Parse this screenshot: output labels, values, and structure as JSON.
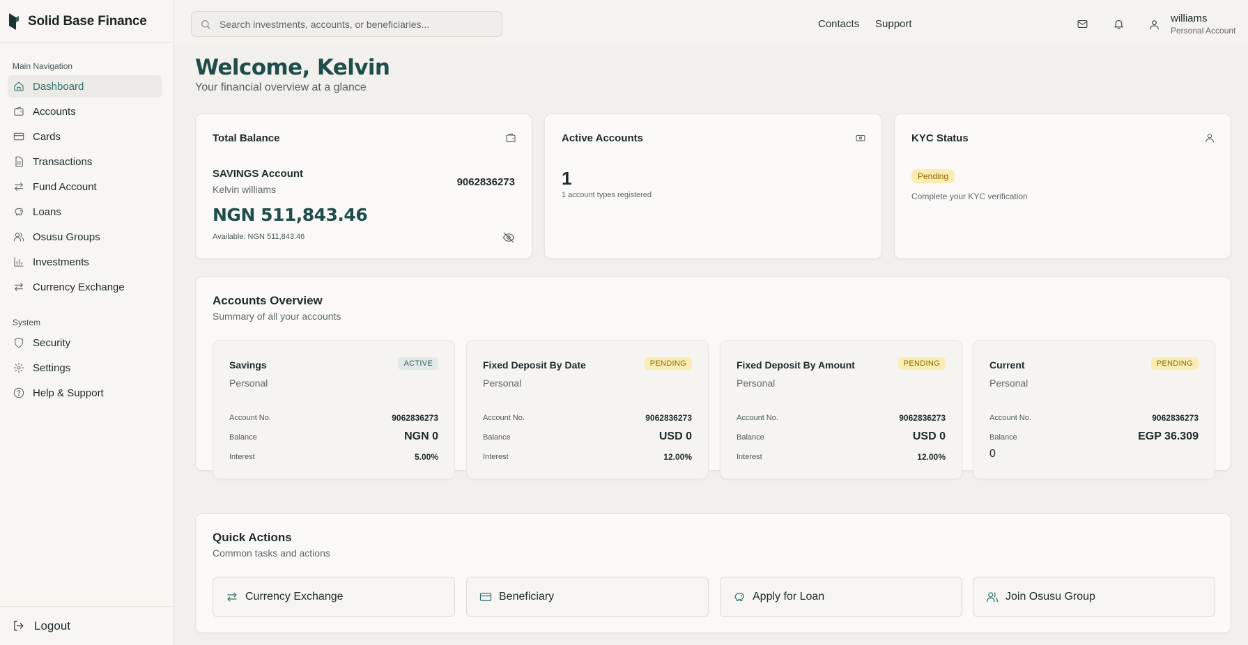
{
  "brand": {
    "name": "Solid Base Finance"
  },
  "sidebar": {
    "main_section": "Main Navigation",
    "items": [
      {
        "label": "Dashboard"
      },
      {
        "label": "Accounts"
      },
      {
        "label": "Cards"
      },
      {
        "label": "Transactions"
      },
      {
        "label": "Fund Account"
      },
      {
        "label": "Loans"
      },
      {
        "label": "Osusu Groups"
      },
      {
        "label": "Investments"
      },
      {
        "label": "Currency Exchange"
      }
    ],
    "system_section": "System",
    "system_items": [
      {
        "label": "Security"
      },
      {
        "label": "Settings"
      },
      {
        "label": "Help & Support"
      }
    ],
    "logout": "Logout"
  },
  "topbar": {
    "search_placeholder": "Search investments, accounts, or beneficiaries...",
    "links": [
      "Contacts",
      "Support"
    ],
    "user_name": "williams",
    "user_type": "Personal Account"
  },
  "welcome": {
    "title": "Welcome, Kelvin",
    "subtitle": "Your financial overview at a glance"
  },
  "total_balance": {
    "title": "Total Balance",
    "account_title": "SAVINGS Account",
    "owner": "Kelvin williams",
    "account_number": "9062836273",
    "balance": "NGN 511,843.46",
    "available": "Available: NGN 511,843.46"
  },
  "active_accounts": {
    "title": "Active Accounts",
    "count": "1",
    "note": "1 account types registered"
  },
  "kyc": {
    "title": "KYC Status",
    "badge": "Pending",
    "note": "Complete your KYC verification"
  },
  "overview": {
    "title": "Accounts Overview",
    "subtitle": "Summary of all your accounts",
    "labels": {
      "account_no": "Account No.",
      "balance": "Balance",
      "interest": "Interest"
    },
    "accounts": [
      {
        "name": "Savings",
        "type": "Personal",
        "status": "ACTIVE",
        "number": "9062836273",
        "balance": "NGN 0",
        "interest": "5.00%"
      },
      {
        "name": "Fixed Deposit By Date",
        "type": "Personal",
        "status": "PENDING",
        "number": "9062836273",
        "balance": "USD 0",
        "interest": "12.00%"
      },
      {
        "name": "Fixed Deposit By Amount",
        "type": "Personal",
        "status": "PENDING",
        "number": "9062836273",
        "balance": "USD 0",
        "interest": "12.00%"
      },
      {
        "name": "Current",
        "type": "Personal",
        "status": "PENDING",
        "number": "9062836273",
        "balance": "EGP 36.309",
        "interest": "0"
      }
    ]
  },
  "quick_actions": {
    "title": "Quick Actions",
    "subtitle": "Common tasks and actions",
    "items": [
      {
        "label": "Currency Exchange",
        "icon": "exchange-icon"
      },
      {
        "label": "Beneficiary",
        "icon": "card-icon"
      },
      {
        "label": "Apply for Loan",
        "icon": "piggy-bank-icon"
      },
      {
        "label": "Join Osusu Group",
        "icon": "users-icon"
      }
    ]
  },
  "colors": {
    "accent": "#1e4d4b",
    "pending": "#fbecb4",
    "active_badge": "#e1eae8"
  }
}
